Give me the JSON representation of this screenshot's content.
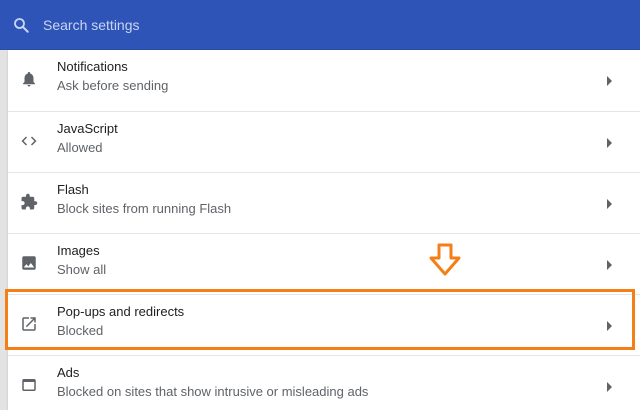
{
  "colors": {
    "header_bg": "#2f54b8",
    "icon": "#5f6368",
    "highlight": "#f57f17"
  },
  "search": {
    "placeholder": "Search settings",
    "icon": "search-icon"
  },
  "rows": [
    {
      "title": "Notifications",
      "subtitle": "Ask before sending",
      "icon": "bell-icon"
    },
    {
      "title": "JavaScript",
      "subtitle": "Allowed",
      "icon": "code-brackets-icon"
    },
    {
      "title": "Flash",
      "subtitle": "Block sites from running Flash",
      "icon": "puzzle-piece-icon"
    },
    {
      "title": "Images",
      "subtitle": "Show all",
      "icon": "image-icon"
    },
    {
      "title": "Pop-ups and redirects",
      "subtitle": "Blocked",
      "icon": "open-in-new-icon"
    },
    {
      "title": "Ads",
      "subtitle": "Blocked on sites that show intrusive or misleading ads",
      "icon": "browser-window-icon"
    }
  ],
  "annotation": {
    "highlighted_row": "Pop-ups and redirects",
    "arrow_icon": "down-arrow-icon"
  }
}
